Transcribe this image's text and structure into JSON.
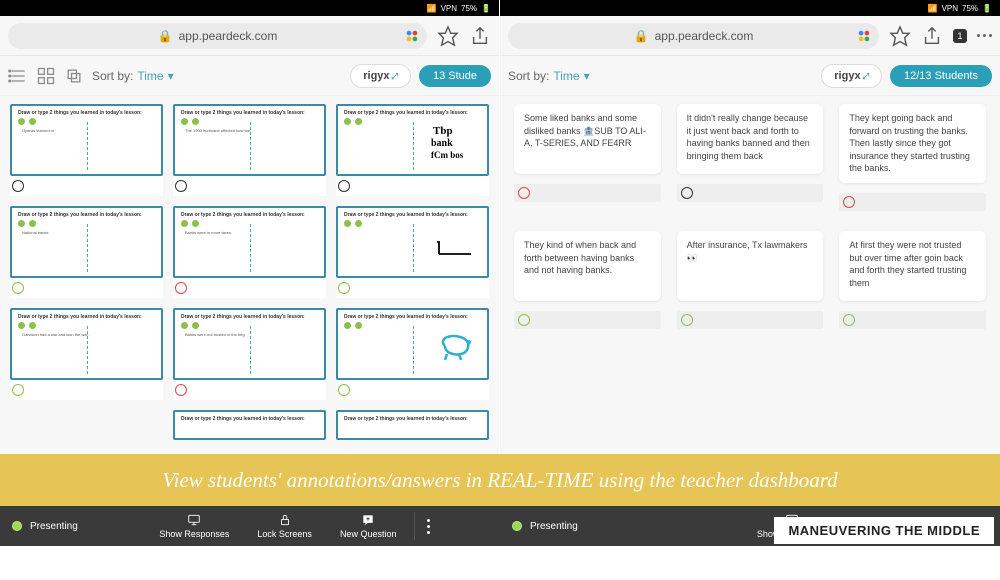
{
  "status": {
    "vpn": "VPN",
    "battery": "75%"
  },
  "url": "app.peardeck.com",
  "sort": {
    "label": "Sort by:",
    "value": "Time"
  },
  "left": {
    "code": "rigyx",
    "students": "13 Stude",
    "prompt": "Draw or type 2 things you learned in today's lesson:",
    "cells": [
      {
        "text": "Operas learned in",
        "face": "b"
      },
      {
        "text": "The 1900 hurricane affected how the",
        "face": "b"
      },
      {
        "text": "",
        "face": "b",
        "draw": "bank"
      },
      {
        "text": "National banks",
        "face": "g"
      },
      {
        "text": "Banks were in more taxes.",
        "face": "r"
      },
      {
        "text": "",
        "face": "g",
        "draw": "line"
      },
      {
        "text": "Galviston had a war and won the war.",
        "face": "g"
      },
      {
        "text": "Banks were not trusted in the beg",
        "face": "r"
      },
      {
        "text": "",
        "face": "g",
        "draw": "pig"
      }
    ]
  },
  "right": {
    "code": "rigyx",
    "students": "12/13 Students",
    "responses": [
      {
        "text": "Some liked banks and some disliked banks 🏦SUB TO ALI-A, T-SERIES, AND FE4RR",
        "face": "r"
      },
      {
        "text": "It didn't really change because it just went back and forth to having banks banned and then bringing them back",
        "face": "b"
      },
      {
        "text": "They kept going back and forward on trusting the banks. Then lastly since they got insurance they started trusting the banks.",
        "face": "r"
      },
      {
        "text": "They kind of when back and forth between having banks and not having banks.",
        "face": "g"
      },
      {
        "text": "After insurance, Tx lawmakers 👀",
        "face": "g"
      },
      {
        "text": "At first they were not trusted but over time after goin back and forth they started trusting them",
        "face": "g"
      }
    ]
  },
  "banner": "View students' annotations/answers in REAL-TIME using the teacher dashboard",
  "bottom": {
    "presenting": "Presenting",
    "show": "Show Responses",
    "lock": "Lock Screens",
    "new": "New Question"
  },
  "watermark": "MANEUVERING THE MIDDLE",
  "tab_count": "1"
}
